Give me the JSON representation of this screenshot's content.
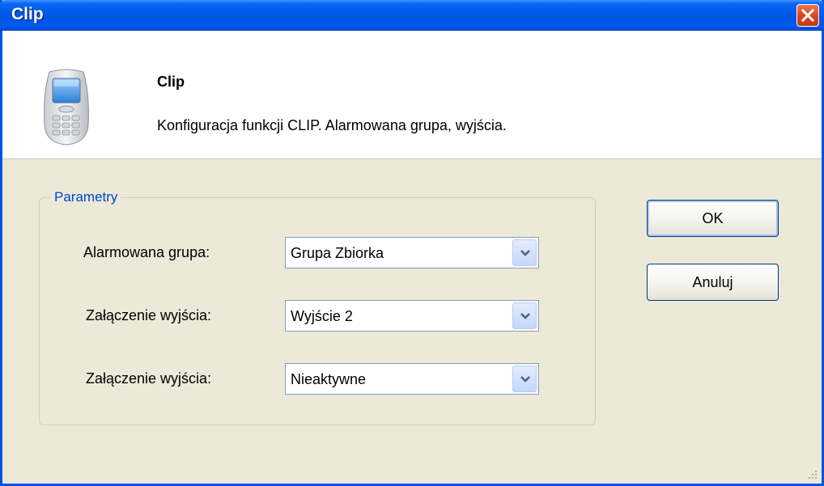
{
  "window": {
    "title": "Clip",
    "close_icon": "close-icon",
    "title_color": "#0054e3",
    "close_color": "#d9441d"
  },
  "header": {
    "icon": "mobile-phone-icon",
    "title": "Clip",
    "description": "Konfiguracja funkcji CLIP. Alarmowana grupa, wyjścia."
  },
  "group": {
    "legend": "Parametry",
    "legend_color": "#0046d5",
    "rows": [
      {
        "label": "Alarmowana grupa:",
        "value": "Grupa Zbiorka"
      },
      {
        "label": "Załączenie wyjścia:",
        "value": "Wyjście 2"
      },
      {
        "label": "Załączenie wyjścia:",
        "value": "Nieaktywne"
      }
    ]
  },
  "buttons": {
    "ok": "OK",
    "cancel": "Anuluj"
  },
  "background_color": "#ece9d8"
}
